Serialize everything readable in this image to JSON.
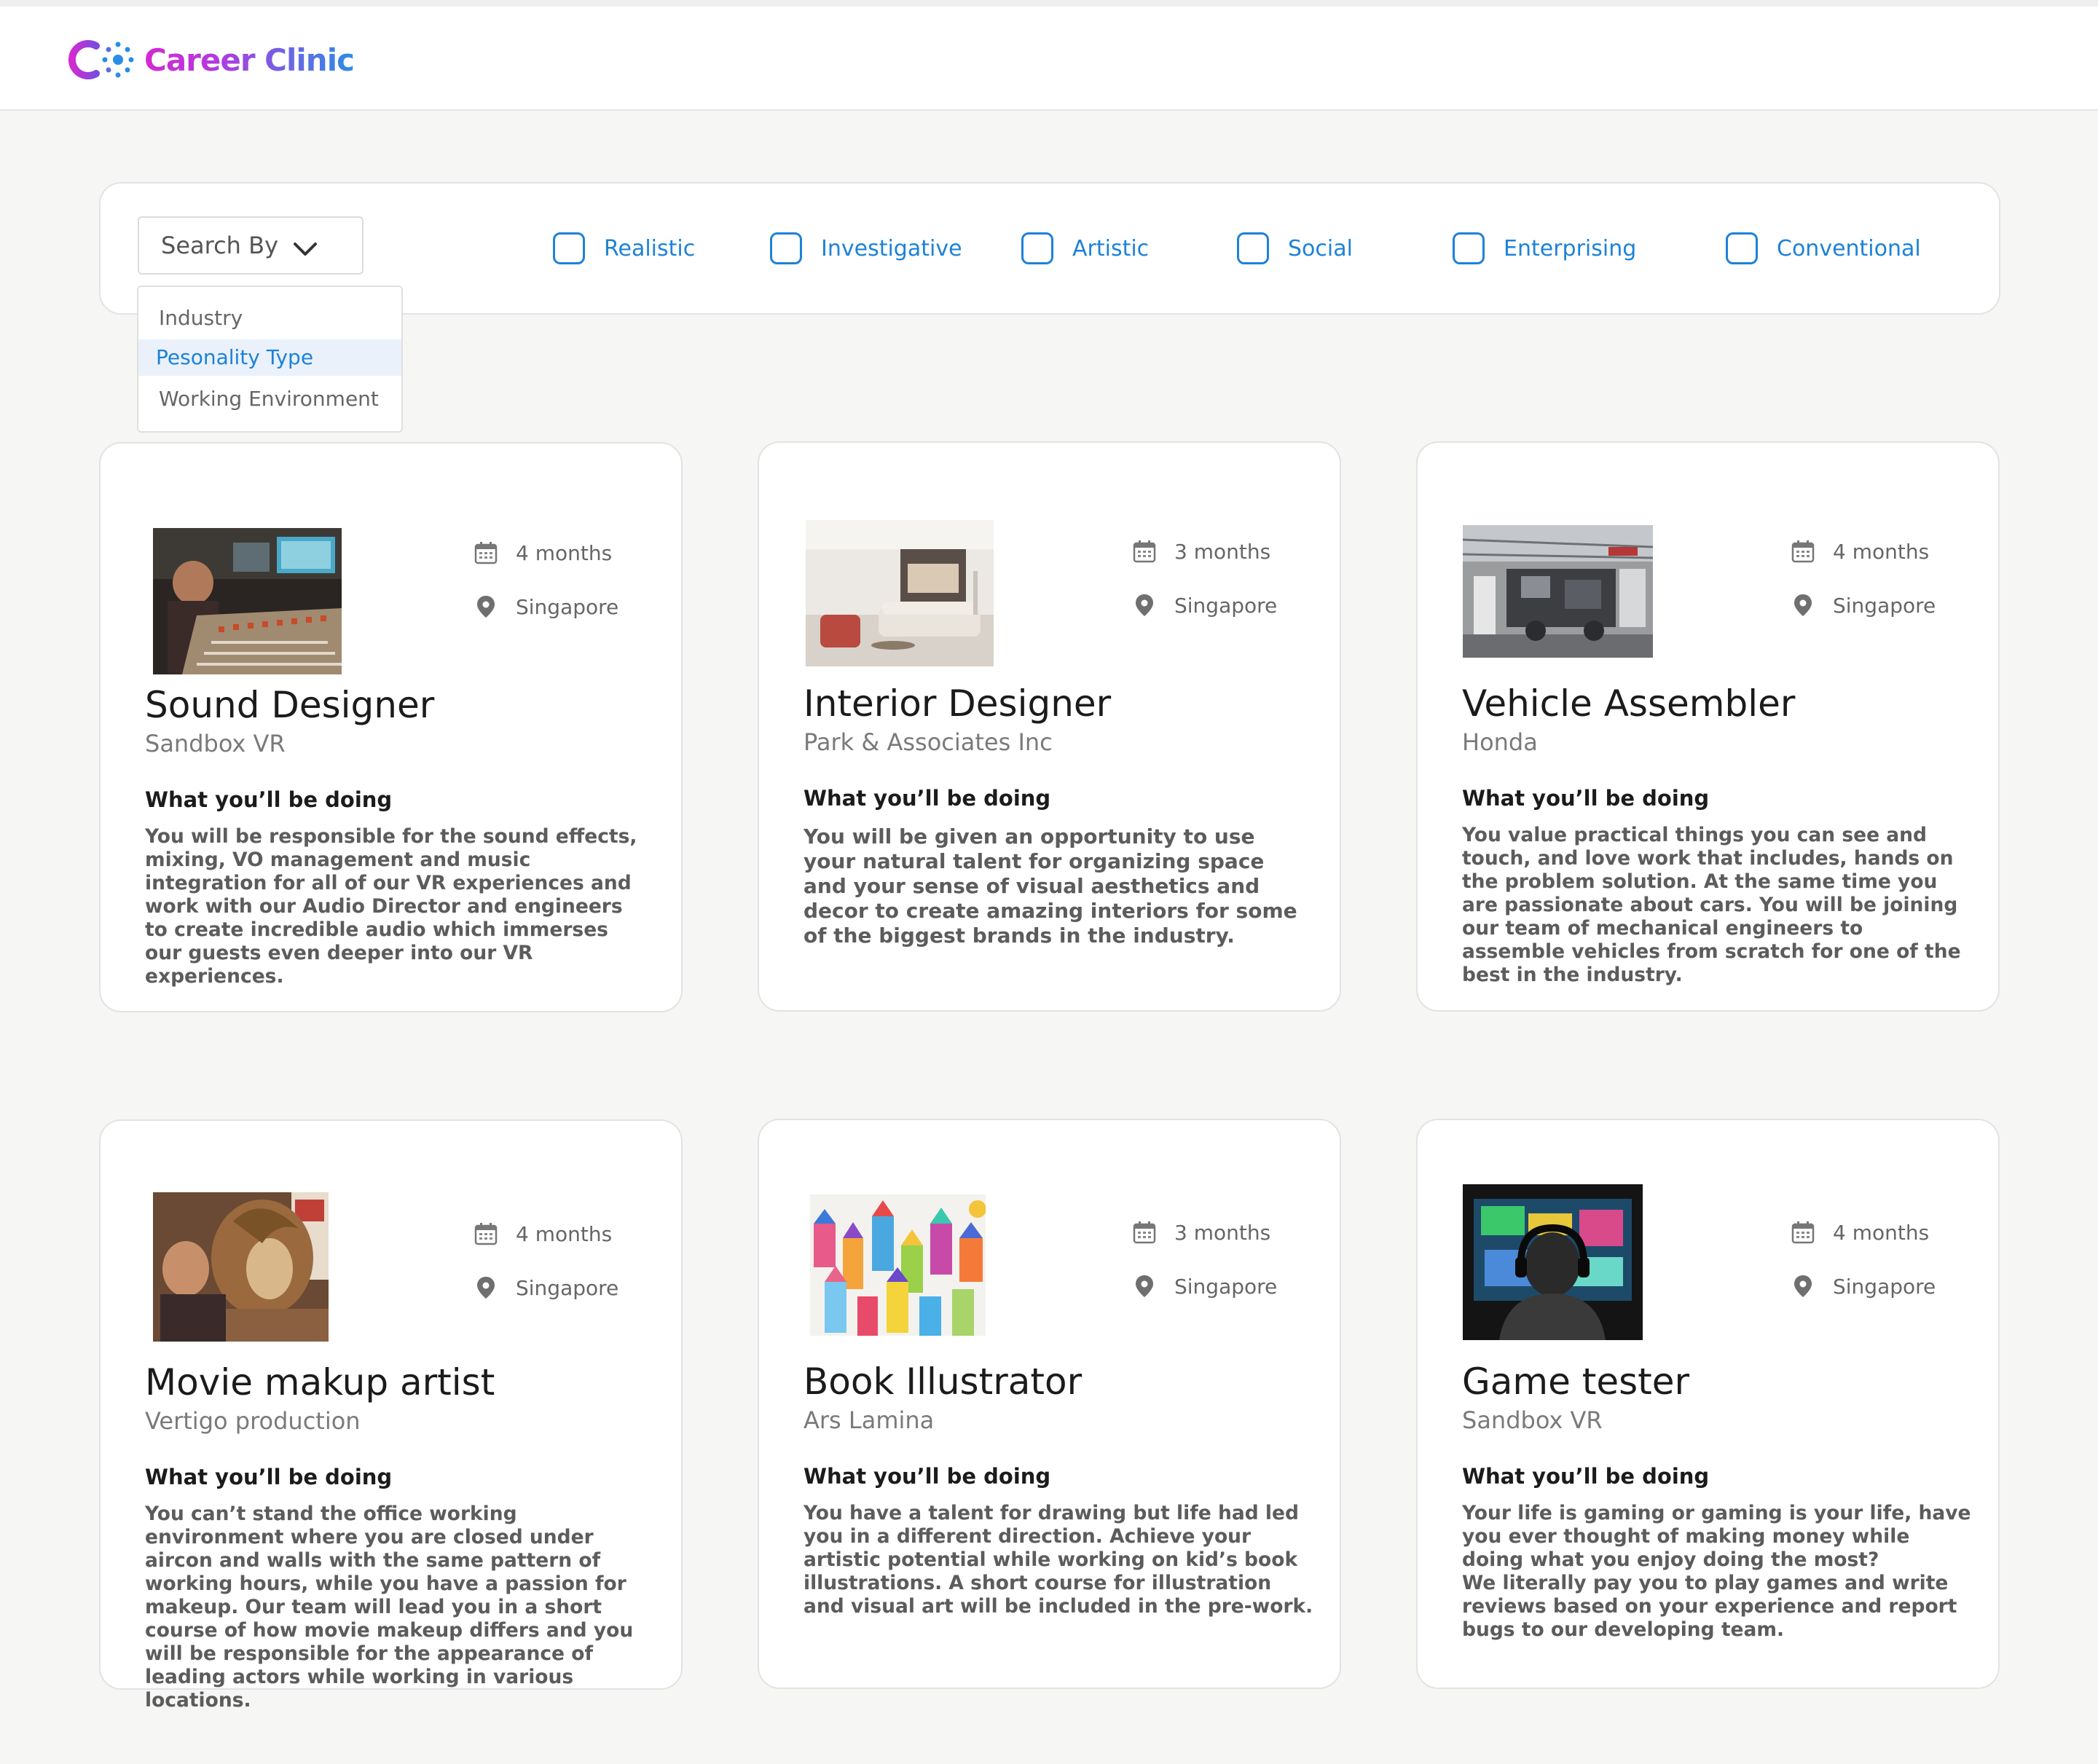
{
  "app": {
    "name": "Career Clinic",
    "colors": {
      "accent": "#1d82d8",
      "brand_magenta": "#d42ad0",
      "background": "#f6f6f4"
    }
  },
  "filter": {
    "search_by_label": "Search By",
    "dropdown_options": [
      "Industry",
      "Pesonality Type",
      "Working Environment"
    ],
    "selected_option": "Pesonality Type",
    "personality_types": [
      "Realistic",
      "Investigative",
      "Artistic",
      "Social",
      "Enterprising",
      "Conventional"
    ]
  },
  "section_heading": "What you’ll be doing",
  "jobs": [
    {
      "title": "Sound Designer",
      "company": "Sandbox VR",
      "duration": "4 months",
      "location": "Singapore",
      "image": "recording-studio-mixing-desk",
      "description": "You will be responsible for the sound effects, mixing, VO management and music integration for all of our VR experiences and work with our Audio Director and engineers to create incredible audio which immerses our guests even deeper into our VR experiences."
    },
    {
      "title": "Interior Designer",
      "company": "Park & Associates Inc",
      "duration": "3 months",
      "location": "Singapore",
      "image": "modern-living-room",
      "description": "You will be given an opportunity to use your natural talent for organizing space and your sense of visual aesthetics and decor to create amazing interiors for some of the biggest brands in the industry."
    },
    {
      "title": "Vehicle Assembler",
      "company": "Honda",
      "duration": "4 months",
      "location": "Singapore",
      "image": "car-assembly-line",
      "description": "You value practical things you can see and touch, and love work that includes, hands on the problem solution. At the same time you are passionate about cars. You will be joining our team of mechanical engineers to assemble vehicles from scratch for one of the best in the industry."
    },
    {
      "title": "Movie makup artist",
      "company": "Vertigo production",
      "duration": "4 months",
      "location": "Singapore",
      "image": "makeup-artist-with-model",
      "description": "You can’t stand the office working environment where you are closed under aircon and walls with the same pattern of working hours, while you have a passion for makeup. Our team will lead you in a short course of how movie makeup differs and you will be responsible for the appearance of leading actors while working in various locations."
    },
    {
      "title": "Book Illustrator",
      "company": "Ars Lamina",
      "duration": "3 months",
      "location": "Singapore",
      "image": "colorful-houses-illustration",
      "description": "You have a talent for drawing but life had led you in a different direction. Achieve your artistic potential while working on kid’s book illustrations. A short course for illustration and visual art will be included in the pre-work."
    },
    {
      "title": "Game tester",
      "company": "Sandbox VR",
      "duration": "4 months",
      "location": "Singapore",
      "image": "gamer-with-headphones",
      "description": " Your life is gaming or gaming is your life, have you ever thought of making money while doing what you enjoy doing the most?\nWe literally pay you to play games and write reviews based on your experience and report bugs to our developing team."
    }
  ]
}
